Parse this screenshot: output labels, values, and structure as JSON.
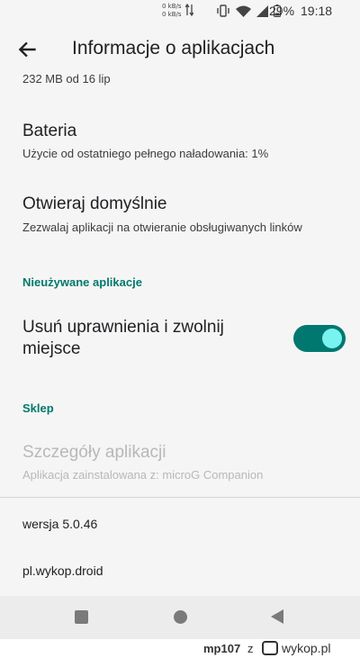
{
  "status_bar": {
    "net_up": "0 kB/s",
    "net_down": "0 kB/s",
    "battery": "29%",
    "time": "19:18",
    "icons": [
      "data-arrows-icon",
      "vibrate-icon",
      "wifi-icon",
      "signal-icon",
      "battery-icon"
    ]
  },
  "app_bar": {
    "title": "Informacje o aplikacjach",
    "back_icon": "arrow-back-icon"
  },
  "storage_summary": "232 MB od 16 lip",
  "battery": {
    "title": "Bateria",
    "subtitle": "Użycie od ostatniego pełnego naładowania: 1%"
  },
  "open_by_default": {
    "title": "Otwieraj domyślnie",
    "subtitle": "Zezwalaj aplikacji na otwieranie obsługiwanych linków"
  },
  "unused_apps": {
    "header": "Nieużywane aplikacje",
    "toggle_label": "Usuń uprawnienia i zwolnij miejsce",
    "toggle_on": true
  },
  "store": {
    "header": "Sklep",
    "title": "Szczegóły aplikacji",
    "subtitle": "Aplikacja zainstalowana z: microG Companion"
  },
  "version": "wersja 5.0.46",
  "package": "pl.wykop.droid",
  "nav": [
    "square-recents-icon",
    "circle-home-icon",
    "triangle-back-icon"
  ],
  "watermark": {
    "user": "mp107",
    "joiner": "z",
    "site": "wykop.pl"
  },
  "colors": {
    "accent": "#00796b",
    "toggle_track": "#00786f",
    "toggle_knob": "#79f3f0",
    "background": "#f5f5f5"
  }
}
